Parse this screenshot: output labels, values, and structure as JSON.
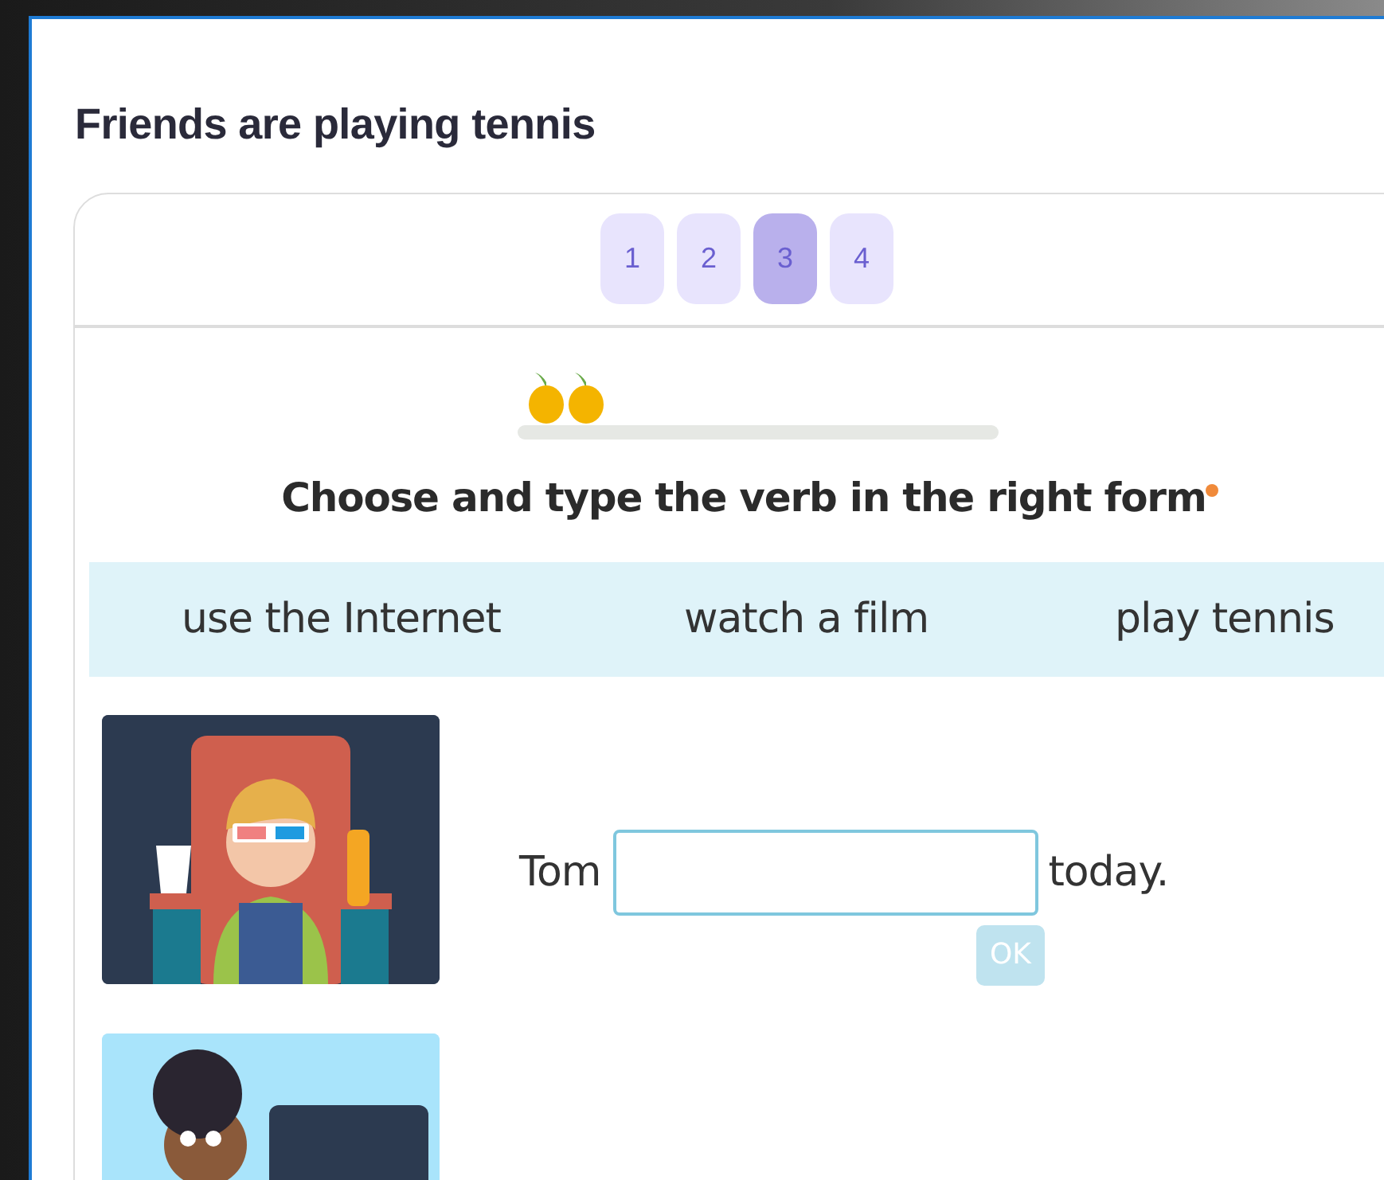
{
  "title": "Friends are playing tennis",
  "pages": [
    {
      "label": "1",
      "selected": false
    },
    {
      "label": "2",
      "selected": false
    },
    {
      "label": "3",
      "selected": true
    },
    {
      "label": "4",
      "selected": false
    }
  ],
  "instruction": "Choose and type the verb in the right form",
  "word_bank": [
    "use the Internet",
    "watch a film",
    "play tennis"
  ],
  "questions": [
    {
      "before": "Tom",
      "after": "today.",
      "ok": {
        "label": "OK",
        "disabled": true
      }
    }
  ]
}
